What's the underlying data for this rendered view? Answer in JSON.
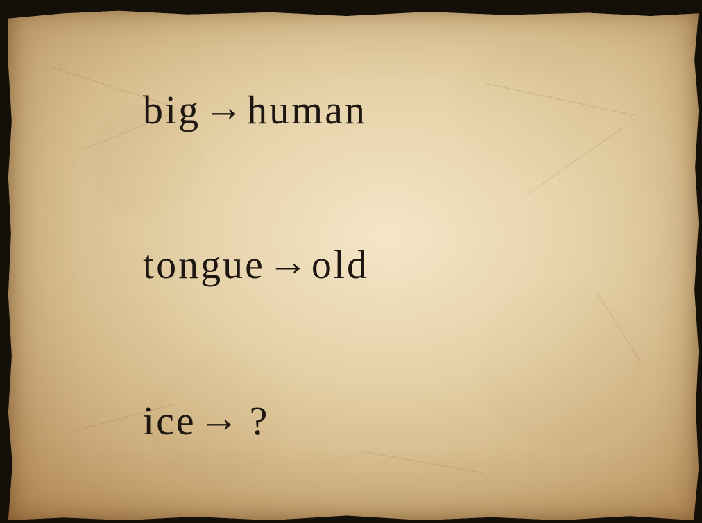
{
  "riddle": {
    "lines": [
      {
        "left": "big",
        "arrow": "→",
        "right": "human"
      },
      {
        "left": "tongue",
        "arrow": "→",
        "right": "old"
      },
      {
        "left": "ice",
        "arrow": "→",
        "right": "?"
      }
    ]
  },
  "colors": {
    "text": "#1d1611",
    "paper": "#e7d2a8",
    "border": "#150f09"
  }
}
